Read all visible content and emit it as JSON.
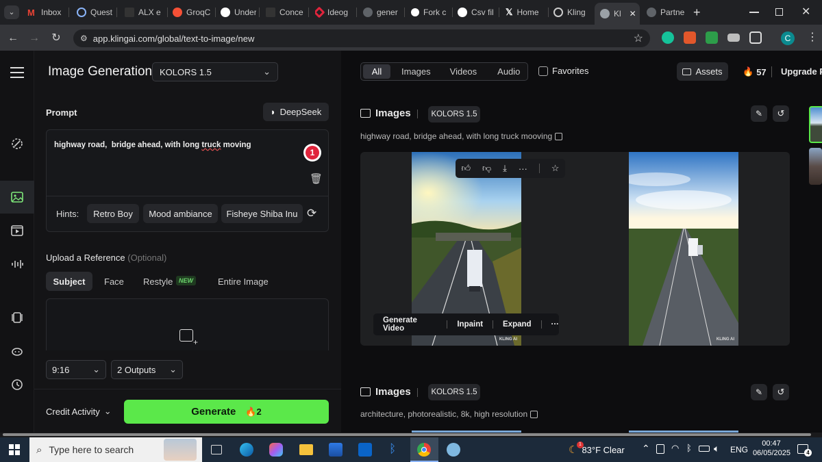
{
  "browser": {
    "tabs": [
      {
        "label": "Inbox",
        "color": "#ea4335"
      },
      {
        "label": "Quest",
        "color": "#8ab4f8"
      },
      {
        "label": "ALX e",
        "color": "#333333"
      },
      {
        "label": "GroqC",
        "color": "#f55036"
      },
      {
        "label": "Under",
        "color": "#ffffff"
      },
      {
        "label": "Conce",
        "color": "#333333"
      },
      {
        "label": "Ideog",
        "color": "#e0243c"
      },
      {
        "label": "gener",
        "color": "#9aa0a6"
      },
      {
        "label": "Fork c",
        "color": "#ffffff"
      },
      {
        "label": "Csv fil",
        "color": "#ffffff"
      },
      {
        "label": "Home",
        "color": "#ffffff"
      },
      {
        "label": "Kling",
        "color": "#cccccc"
      },
      {
        "label": "Kl",
        "color": "#9aa0a6"
      },
      {
        "label": "Partne",
        "color": "#9aa0a6"
      }
    ],
    "close_tab": "✕",
    "new_tab": "+",
    "url": "app.klingai.com/global/text-to-image/new",
    "profile_letter": "C"
  },
  "header": {
    "title": "Image Generation",
    "model": "KOLORS 1.5",
    "filters": [
      "All",
      "Images",
      "Videos",
      "Audio"
    ],
    "active_filter": "All",
    "favorites": "Favorites",
    "assets": "Assets",
    "credits": "57",
    "upgrade": "Upgrade P"
  },
  "prompt": {
    "label": "Prompt",
    "deepseek": "DeepSeek",
    "text_before": "highway road,  bridge ahead, with long ",
    "text_misspelled": "truck",
    "text_after": " moving",
    "badge": "1",
    "hints_label": "Hints:",
    "hints": [
      "Retro Boy",
      "Mood ambiance",
      "Fisheye Shiba Inu"
    ]
  },
  "reference": {
    "label": "Upload a Reference",
    "optional": "(Optional)",
    "tabs": [
      "Subject",
      "Face",
      "Restyle",
      "Entire Image"
    ],
    "new_badge": "NEW"
  },
  "settings": {
    "ratio": "9:16",
    "outputs": "2 Outputs",
    "credit_activity": "Credit Activity",
    "generate": "Generate",
    "generate_cost": "2"
  },
  "results": [
    {
      "section": "Images",
      "model": "KOLORS 1.5",
      "prompt": "highway road, bridge ahead, with long truck mooving"
    },
    {
      "section": "Images",
      "model": "KOLORS 1.5",
      "prompt": "architecture, photorealistic, 8k, high resolution"
    }
  ],
  "image_actions": [
    "Generate Video",
    "Inpaint",
    "Expand"
  ],
  "more": "···",
  "watermark": "KLING AI",
  "taskbar": {
    "search_placeholder": "Type here to search",
    "weather": "83°F  Clear",
    "weather_badge": "1",
    "lang": "ENG",
    "time": "00:47",
    "date": "06/05/2025",
    "notif_count": "4"
  }
}
